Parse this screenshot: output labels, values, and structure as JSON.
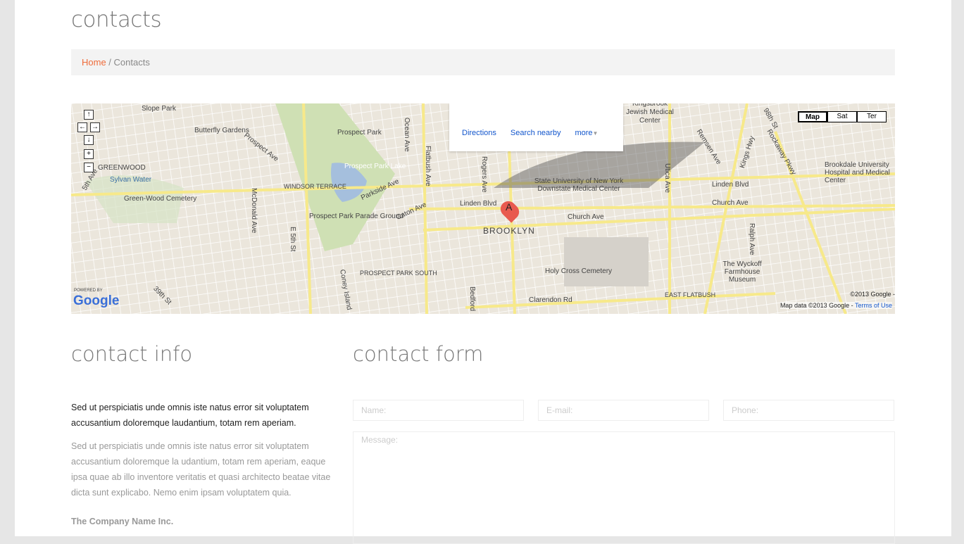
{
  "page": {
    "title": "contacts"
  },
  "breadcrumb": {
    "home": "Home",
    "separator": " / ",
    "current": "Contacts"
  },
  "map": {
    "bubble": {
      "directions": "Directions",
      "search_nearby": "Search nearby",
      "more": "more"
    },
    "types": {
      "map": "Map",
      "sat": "Sat",
      "ter": "Ter"
    },
    "marker": "A",
    "labels": [
      "Slope Park",
      "Butterfly Gardens",
      "Prospect Park",
      "Prospect Park Lake",
      "GREENWOOD",
      "Sylvan Water",
      "Green-Wood Cemetery",
      "WINDSOR TERRACE",
      "Prospect Park Parade Ground",
      "Prospect Ave",
      "Parkside Ave",
      "Caton Ave",
      "Ocean Ave",
      "Flatbush Ave",
      "Rogers Ave",
      "Linden Blvd",
      "Church Ave",
      "BROOKLYN",
      "State University of New York Downstate Medical Center",
      "Kingsbrook Jewish Medical Center",
      "Holy Cross Cemetery",
      "PROSPECT PARK SOUTH",
      "Clarendon Rd",
      "EAST FLATBUSH",
      "The Wyckoff Farmhouse Museum",
      "Brookdale University Hospital and Medical Center",
      "Remsen Ave",
      "Kings Hwy",
      "Utica Ave",
      "Rockaway Pkwy",
      "McDonald Ave",
      "E 5th St",
      "Coney Island",
      "Bedford",
      "5th Ave",
      "39th St",
      "98th St",
      "Ralph Ave"
    ],
    "powered_by": "POWERED BY",
    "logo": "Google",
    "copyright": "©2013 Google -",
    "map_data": "Map data ©2013 Google -",
    "terms": "Terms of Use"
  },
  "contact_info": {
    "title": "contact info",
    "lead": "Sed ut perspiciatis unde omnis iste natus error sit voluptatem accusantium doloremque laudantium, totam rem aperiam.",
    "body": "Sed ut perspiciatis unde omnis iste natus error sit voluptatem accusantium doloremque la udantium, totam rem aperiam, eaque ipsa quae ab illo inventore veritatis et quasi architecto beatae vitae dicta sunt explicabo. Nemo enim ipsam voluptatem quia.",
    "company": "The Company Name Inc."
  },
  "contact_form": {
    "title": "contact form",
    "name_placeholder": "Name:",
    "email_placeholder": "E-mail:",
    "phone_placeholder": "Phone:",
    "message_placeholder": "Message:"
  }
}
